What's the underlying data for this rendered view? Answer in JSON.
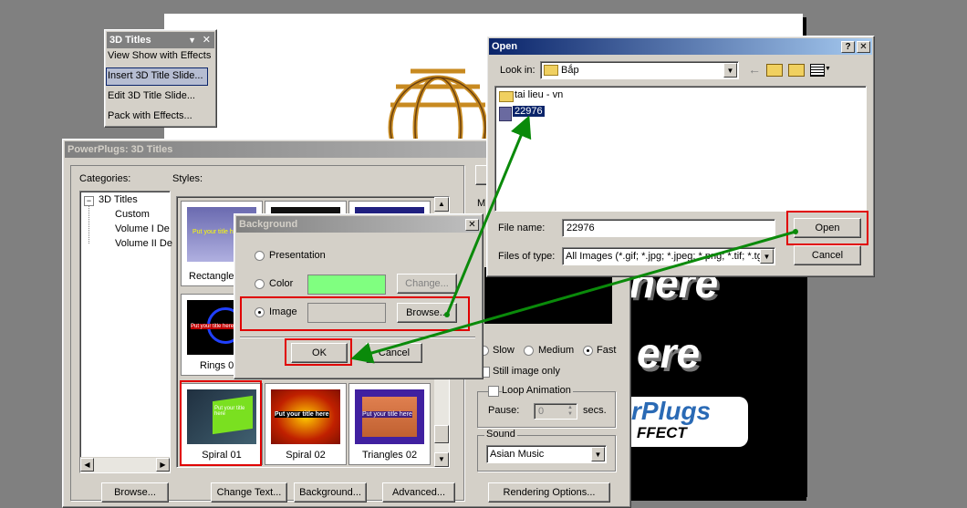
{
  "toolbar3d": {
    "title": "3D Titles",
    "items": [
      "View Show with Effects",
      "Insert 3D Title Slide...",
      "Edit 3D Title Slide...",
      "Pack with Effects..."
    ]
  },
  "main_dialog": {
    "title": "PowerPlugs: 3D Titles",
    "categories_label": "Categories:",
    "styles_label": "Styles:",
    "tree": [
      "3D Titles",
      "Custom",
      "Volume I De",
      "Volume II De"
    ],
    "thumbs": [
      {
        "caption": "Rectangles",
        "text": "Put your title here"
      },
      {
        "caption": "Rings 05",
        "text": "Put your title here"
      },
      {
        "caption": "Spiral 01",
        "text": "Put your title here"
      },
      {
        "caption": "Spiral 02",
        "text": "Put your title here"
      },
      {
        "caption": "Triangles 02",
        "text": "Put your title here"
      }
    ],
    "buttons": {
      "browse": "Browse...",
      "change_text": "Change Text...",
      "background": "Background...",
      "advanced": "Advanced...",
      "rendering": "Rendering Options..."
    },
    "right_panel_m": "M",
    "speed": {
      "slow": "Slow",
      "medium": "Medium",
      "fast": "Fast"
    },
    "still_image": "Still image only",
    "loop_group": "Loop Animation",
    "pause_label": "Pause:",
    "pause_value": "0",
    "secs": "secs.",
    "sound_label": "Sound",
    "sound_value": "Asian Music",
    "preview_text_1": "here",
    "preview_text_2": "ere",
    "logo_text": "rPlugs",
    "logo_sub": "FFECT"
  },
  "background_dialog": {
    "title": "Background",
    "presentation": "Presentation",
    "color": "Color",
    "image": "Image",
    "change": "Change...",
    "browse": "Browse...",
    "ok": "OK",
    "cancel": "Cancel",
    "color_swatch": "#80ff80"
  },
  "open_dialog": {
    "title": "Open",
    "look_in_label": "Look in:",
    "look_in_value": "Bắp",
    "files": [
      {
        "name": "tai lieu - vn",
        "icon": "folder-icon"
      },
      {
        "name": "22976",
        "icon": "image-file-icon"
      }
    ],
    "file_name_label": "File name:",
    "file_name_value": "22976",
    "files_of_type_label": "Files of type:",
    "files_of_type_value": "All Images (*.gif; *.jpg; *.jpeg; *.png; *.tif; *.tga",
    "open": "Open",
    "cancel": "Cancel"
  },
  "colors": {
    "accent": "#0a246a",
    "highlight_red": "#e00000",
    "arrow_green": "#0a8a0a"
  }
}
